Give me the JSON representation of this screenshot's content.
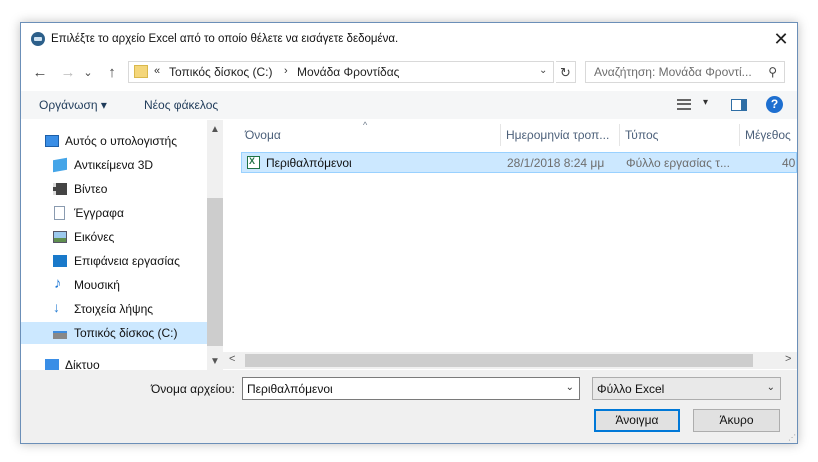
{
  "window": {
    "title": "Επιλέξτε το αρχείο Excel από το οποίο θέλετε να εισάγετε δεδομένα.",
    "close_glyph": "✕"
  },
  "address": {
    "back_glyph": "←",
    "forward_glyph": "→",
    "history_glyph": "⌄",
    "up_glyph": "↑",
    "overflow": "«",
    "crumbs": [
      "Τοπικός δίσκος (C:)",
      "Μονάδα Φροντίδας"
    ],
    "separator": "›",
    "dropdown_glyph": "⌄",
    "refresh_glyph": "↻"
  },
  "search": {
    "placeholder": "Αναζήτηση: Μονάδα Φροντί...",
    "icon_glyph": "⚲"
  },
  "toolbar": {
    "organize": "Οργάνωση ▾",
    "new_folder": "Νέος φάκελος",
    "help": "?",
    "view_dropdown": "▾"
  },
  "sidebar": {
    "items": [
      {
        "label": "Αυτός ο υπολογιστής",
        "icon": "computer-icon"
      },
      {
        "label": "Αντικείμενα 3D",
        "icon": "cube-icon"
      },
      {
        "label": "Βίντεο",
        "icon": "film-icon"
      },
      {
        "label": "Έγγραφα",
        "icon": "document-icon"
      },
      {
        "label": "Εικόνες",
        "icon": "picture-icon"
      },
      {
        "label": "Επιφάνεια εργασίας",
        "icon": "desktop-icon"
      },
      {
        "label": "Μουσική",
        "icon": "music-note-icon"
      },
      {
        "label": "Στοιχεία λήψης",
        "icon": "download-arrow-icon"
      },
      {
        "label": "Τοπικός δίσκος (C:)",
        "icon": "drive-icon",
        "selected": true
      },
      {
        "label": "Δίκτυο",
        "icon": "network-icon"
      }
    ],
    "scroll_up": "▲",
    "scroll_down": "▼"
  },
  "file_list": {
    "columns": [
      "Όνομα",
      "Ημερομηνία τροπ...",
      "Τύπος",
      "Μέγεθος"
    ],
    "sort_glyph": "^",
    "rows": [
      {
        "name": "Περιθαλπόμενοι",
        "date": "28/1/2018 8:24 μμ",
        "type": "Φύλλο εργασίας τ...",
        "size": "40",
        "icon": "excel-icon",
        "selected": true
      }
    ],
    "scroll_left": "<",
    "scroll_right": ">"
  },
  "footer": {
    "filename_label": "Όνομα αρχείου:",
    "filename_value": "Περιθαλπόμενοι",
    "filetype_value": "Φύλλο Excel",
    "dropdown_glyph": "⌄",
    "open_button": "Άνοιγμα",
    "cancel_button": "Άκυρο",
    "grip": "⋰"
  },
  "colors": {
    "selection": "#cce8ff",
    "accent": "#0078d7",
    "excel_green": "#207245"
  }
}
